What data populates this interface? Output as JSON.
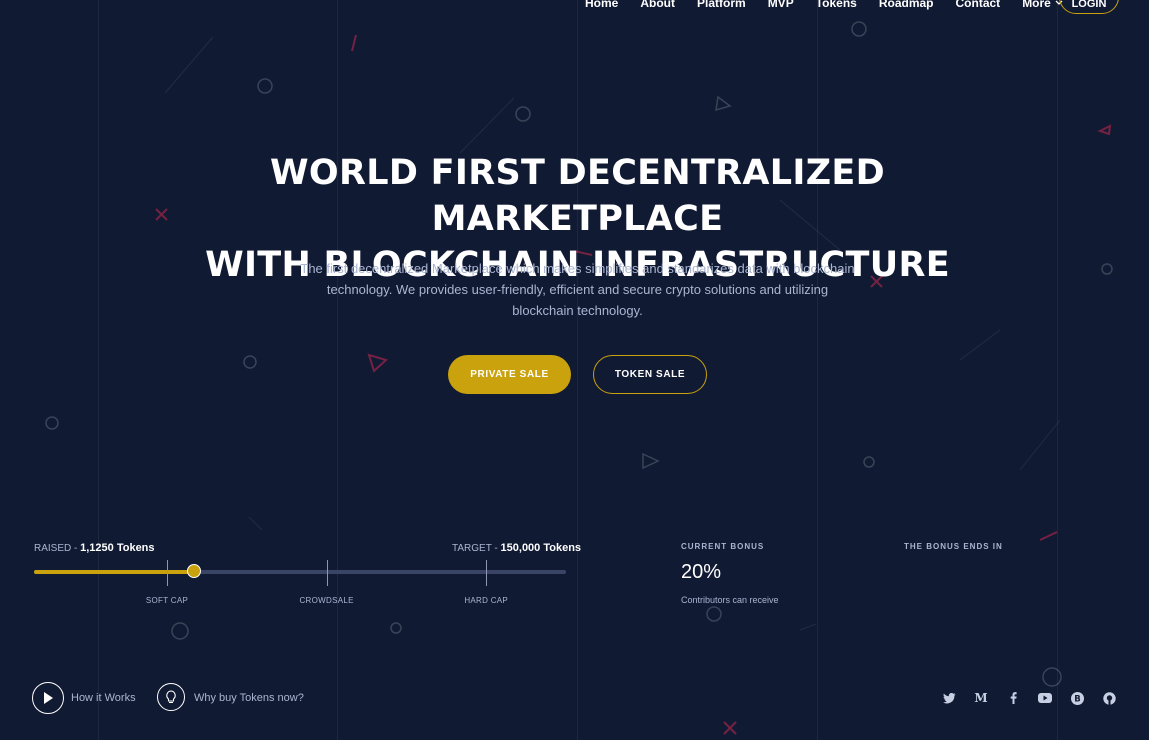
{
  "nav": {
    "items": [
      "Home",
      "About",
      "Platform",
      "MVP",
      "Tokens",
      "Roadmap",
      "Contact",
      "More"
    ],
    "login_label": "LOGIN"
  },
  "hero": {
    "title_line1": "WORLD FIRST DECENTRALIZED MARKETPLACE",
    "title_line2": "WITH BLOCKCHAIN INFRASTRUCTURE",
    "subtitle": "The first decentralized Marketplace which makes simplifies and standarizes data with blockchain technology. We provides user-friendly, efficient and secure crypto solutions and utilizing blockchain technology.",
    "private_sale_label": "PRIVATE SALE",
    "token_sale_label": "TOKEN SALE"
  },
  "progress": {
    "raised_label": "RAISED -",
    "raised_value": "1,1250 Tokens",
    "target_label": "TARGET -",
    "target_value": "150,000 Tokens",
    "fill_fraction": 0.3,
    "markers": [
      {
        "label": "SOFT CAP",
        "fraction": 0.25
      },
      {
        "label": "CROWDSALE",
        "fraction": 0.55
      },
      {
        "label": "HARD CAP",
        "fraction": 0.85
      }
    ]
  },
  "bonus": {
    "title": "CURRENT BONUS",
    "value": "20%",
    "note": "Contributors can receive",
    "ends_title": "THE BONUS ENDS IN"
  },
  "footer": {
    "how_label": "How it Works",
    "why_label": "Why buy Tokens now?",
    "social_icons": [
      "twitter-icon",
      "medium-icon",
      "facebook-icon",
      "youtube-icon",
      "bitcoin-icon",
      "github-icon"
    ]
  },
  "colors": {
    "background": "#111a33",
    "accent": "#c9a20d",
    "muted_text": "#aab5d1"
  }
}
